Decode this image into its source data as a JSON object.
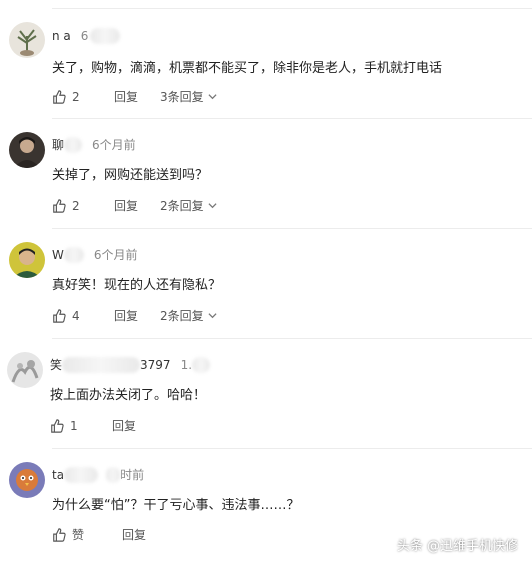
{
  "comments": [
    {
      "username": "n   a",
      "time": "6",
      "text": "关了，购物，滴滴，机票都不能买了，除非你是老人，手机就打电话",
      "likes": "2",
      "reply_label": "回复",
      "more_replies": "3条回复"
    },
    {
      "username": "聊",
      "time": "6个月前",
      "text": "关掉了，网购还能送到吗？",
      "likes": "2",
      "reply_label": "回复",
      "more_replies": "2条回复"
    },
    {
      "username": "W",
      "time": "6个月前",
      "text": "真好笑！现在的人还有隐私？",
      "likes": "4",
      "reply_label": "回复",
      "more_replies": "2条回复"
    },
    {
      "username": "笑",
      "user_suffix": "3797",
      "time": "1.",
      "text": "按上面办法关闭了。哈哈！",
      "likes": "1",
      "reply_label": "回复"
    },
    {
      "username": "ta",
      "time": "时前",
      "text": "为什么要“怕”？干了亏心事、违法事……？",
      "likes": "赞",
      "reply_label": "回复"
    }
  ],
  "watermark": "头条 @迅维手机快修",
  "colors": {
    "text": "#222222",
    "muted": "#888888",
    "divider": "#ececec"
  }
}
